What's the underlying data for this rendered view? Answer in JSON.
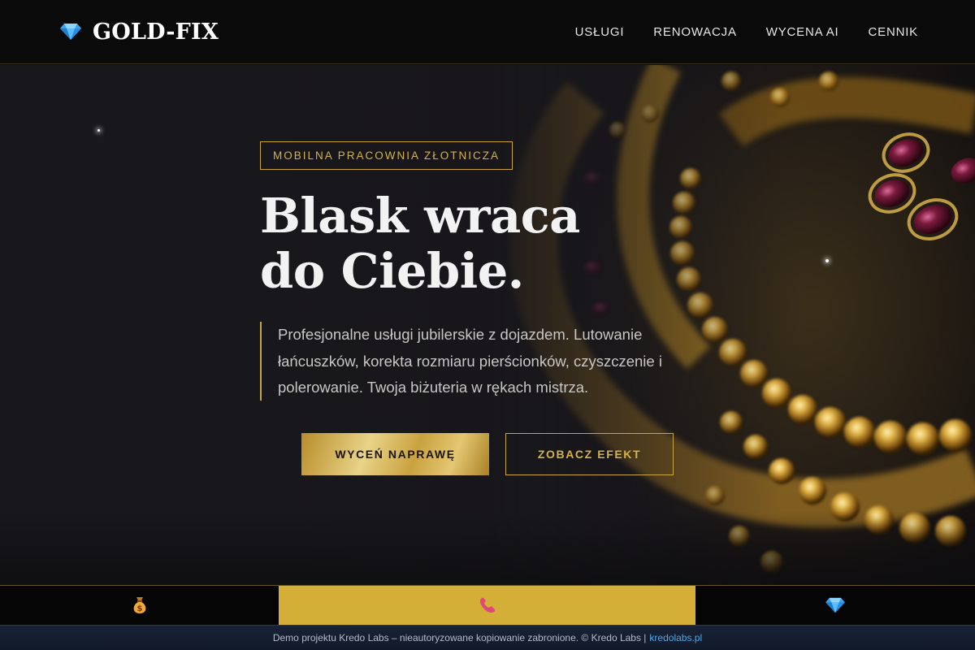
{
  "brand": {
    "name": "GOLD-FIX",
    "icon": "diamond-icon"
  },
  "nav": {
    "items": [
      "USŁUGI",
      "RENOWACJA",
      "WYCENA AI",
      "CENNIK"
    ]
  },
  "hero": {
    "badge": "MOBILNA PRACOWNIA ZŁOTNICZA",
    "headline_line1": "Blask wraca",
    "headline_line2": "do Ciebie.",
    "lead": "Profesjonalne usługi jubilerskie z dojazdem. Lutowanie łańcuszków, korekta rozmiaru pierścionków, czyszczenie i polerowanie. Twoja biżuteria w rękach mistrza.",
    "cta_primary": "WYCEŃ NAPRAWĘ",
    "cta_secondary": "ZOBACZ EFEKT"
  },
  "bottom_bar": {
    "items": [
      {
        "icon": "money-bag-icon"
      },
      {
        "icon": "phone-icon"
      },
      {
        "icon": "diamond-icon"
      }
    ]
  },
  "footer": {
    "text": "Demo projektu Kredo Labs – nieautoryzowane kopiowanie zabronione. © Kredo Labs |",
    "link": "kredolabs.pl"
  },
  "colors": {
    "gold": "#d4af37",
    "background": "#18171b",
    "footer_link": "#4fa8e8"
  }
}
